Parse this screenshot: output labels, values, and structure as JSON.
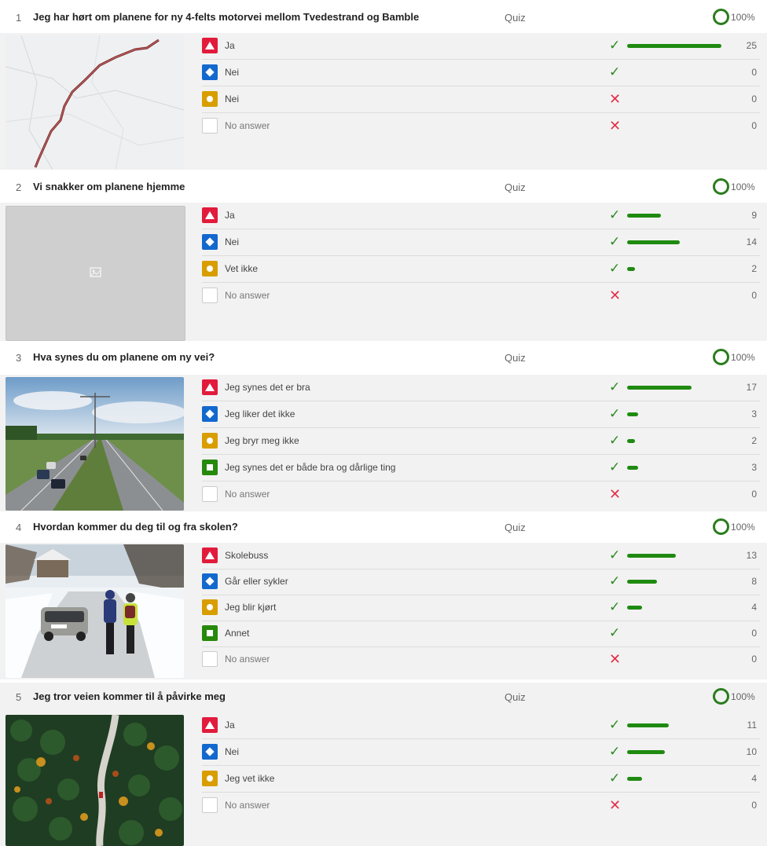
{
  "questions": [
    {
      "number": "1",
      "title": "Jeg har hørt om planene for ny 4-felts motorvei mellom Tvedestrand og Bamble",
      "type": "Quiz",
      "percent": "100%",
      "image": "map-thumbnail",
      "answers": [
        {
          "symbol": "triangle",
          "label": "Ja",
          "correct": true,
          "count": "25",
          "fraction": 1.0
        },
        {
          "symbol": "diamond",
          "label": "Nei",
          "correct": true,
          "count": "0",
          "fraction": 0
        },
        {
          "symbol": "circle",
          "label": "Nei",
          "correct": false,
          "count": "0",
          "fraction": 0
        },
        {
          "symbol": "none",
          "label": "No answer",
          "correct": false,
          "count": "0",
          "fraction": 0
        }
      ]
    },
    {
      "number": "2",
      "title": "Vi snakker om planene hjemme",
      "type": "Quiz",
      "percent": "100%",
      "image": "image-placeholder",
      "answers": [
        {
          "symbol": "triangle",
          "label": "Ja",
          "correct": true,
          "count": "9",
          "fraction": 0.36
        },
        {
          "symbol": "diamond",
          "label": "Nei",
          "correct": true,
          "count": "14",
          "fraction": 0.56
        },
        {
          "symbol": "circle",
          "label": "Vet ikke",
          "correct": true,
          "count": "2",
          "fraction": 0.08
        },
        {
          "symbol": "none",
          "label": "No answer",
          "correct": false,
          "count": "0",
          "fraction": 0
        }
      ]
    },
    {
      "number": "3",
      "title": "Hva synes du om planene om ny vei?",
      "type": "Quiz",
      "percent": "100%",
      "image": "highway-photo",
      "answers": [
        {
          "symbol": "triangle",
          "label": "Jeg synes det er bra",
          "correct": true,
          "count": "17",
          "fraction": 0.68
        },
        {
          "symbol": "diamond",
          "label": "Jeg liker det ikke",
          "correct": true,
          "count": "3",
          "fraction": 0.12
        },
        {
          "symbol": "circle",
          "label": "Jeg bryr meg ikke",
          "correct": true,
          "count": "2",
          "fraction": 0.08
        },
        {
          "symbol": "square",
          "label": "Jeg synes det er både bra og dårlige ting",
          "correct": true,
          "count": "3",
          "fraction": 0.12
        },
        {
          "symbol": "none",
          "label": "No answer",
          "correct": false,
          "count": "0",
          "fraction": 0
        }
      ]
    },
    {
      "number": "4",
      "title": "Hvordan kommer du deg til og fra skolen?",
      "type": "Quiz",
      "percent": "100%",
      "image": "snowy-road-photo",
      "answers": [
        {
          "symbol": "triangle",
          "label": "Skolebuss",
          "correct": true,
          "count": "13",
          "fraction": 0.52
        },
        {
          "symbol": "diamond",
          "label": "Går eller sykler",
          "correct": true,
          "count": "8",
          "fraction": 0.32
        },
        {
          "symbol": "circle",
          "label": "Jeg blir kjørt",
          "correct": true,
          "count": "4",
          "fraction": 0.16
        },
        {
          "symbol": "square",
          "label": "Annet",
          "correct": true,
          "count": "0",
          "fraction": 0
        },
        {
          "symbol": "none",
          "label": "No answer",
          "correct": false,
          "count": "0",
          "fraction": 0
        }
      ]
    },
    {
      "number": "5",
      "title": "Jeg tror veien kommer til å påvirke meg",
      "type": "Quiz",
      "percent": "100%",
      "image": "forest-road-photo",
      "answers": [
        {
          "symbol": "triangle",
          "label": "Ja",
          "correct": true,
          "count": "11",
          "fraction": 0.44
        },
        {
          "symbol": "diamond",
          "label": "Nei",
          "correct": true,
          "count": "10",
          "fraction": 0.4
        },
        {
          "symbol": "circle",
          "label": "Jeg vet ikke",
          "correct": true,
          "count": "4",
          "fraction": 0.16
        },
        {
          "symbol": "none",
          "label": "No answer",
          "correct": false,
          "count": "0",
          "fraction": 0
        }
      ]
    }
  ],
  "colors": {
    "triangle": "#e21b3c",
    "diamond": "#1368ce",
    "circle": "#d89e00",
    "square": "#26890c",
    "bar": "#1f8a10",
    "ring": "#2a7d1c"
  }
}
